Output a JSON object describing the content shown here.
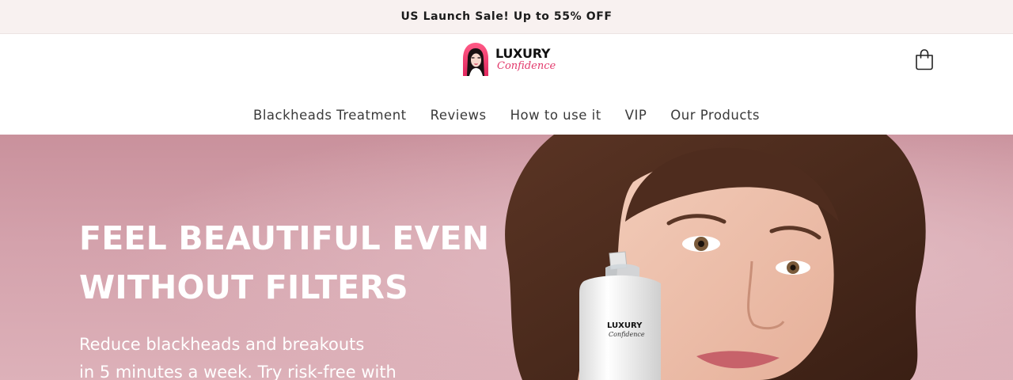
{
  "announcement": {
    "text": "US Launch Sale! Up to 55% OFF"
  },
  "brand": {
    "name_line1": "LUXURY",
    "name_line2": "Confidence"
  },
  "nav": {
    "items": [
      {
        "label": "Blackheads Treatment"
      },
      {
        "label": "Reviews"
      },
      {
        "label": "How to use it"
      },
      {
        "label": "VIP"
      },
      {
        "label": "Our Products"
      }
    ]
  },
  "hero": {
    "heading_line1": "FEEL BEAUTIFUL EVEN",
    "heading_line2": "WITHOUT FILTERS",
    "subtext_line1": "Reduce blackheads and breakouts",
    "subtext_line2": "in 5 minutes a week. Try risk-free with",
    "device_label_line1": "LUXURY",
    "device_label_line2": "Confidence"
  },
  "icons": {
    "cart": "cart-icon",
    "logo": "logo-icon"
  },
  "colors": {
    "announcement_bg": "#f8f1f0",
    "brand_pink": "#e23a6c",
    "hero_bg": "#d4a2ac",
    "text_white": "#ffffff"
  }
}
